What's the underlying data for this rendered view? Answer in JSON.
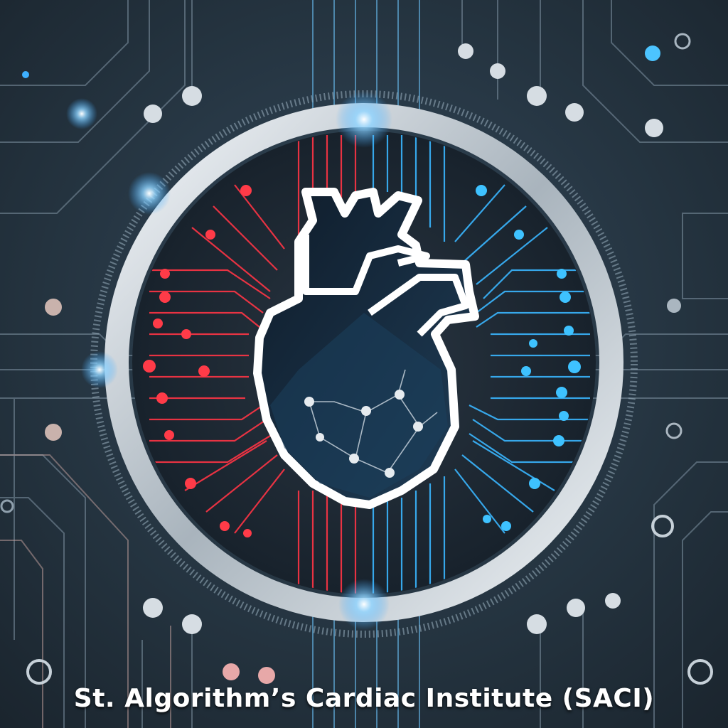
{
  "caption": "St. Algorithm’s Cardiac Institute (SACI)",
  "colors": {
    "background": "#22303c",
    "red_accent": "#ff3040",
    "blue_accent": "#40b8ff",
    "ring": "#dfe6ec",
    "heart": "#14273a"
  },
  "icons": [
    "circuit-board",
    "heart-icon",
    "silver-ring"
  ]
}
